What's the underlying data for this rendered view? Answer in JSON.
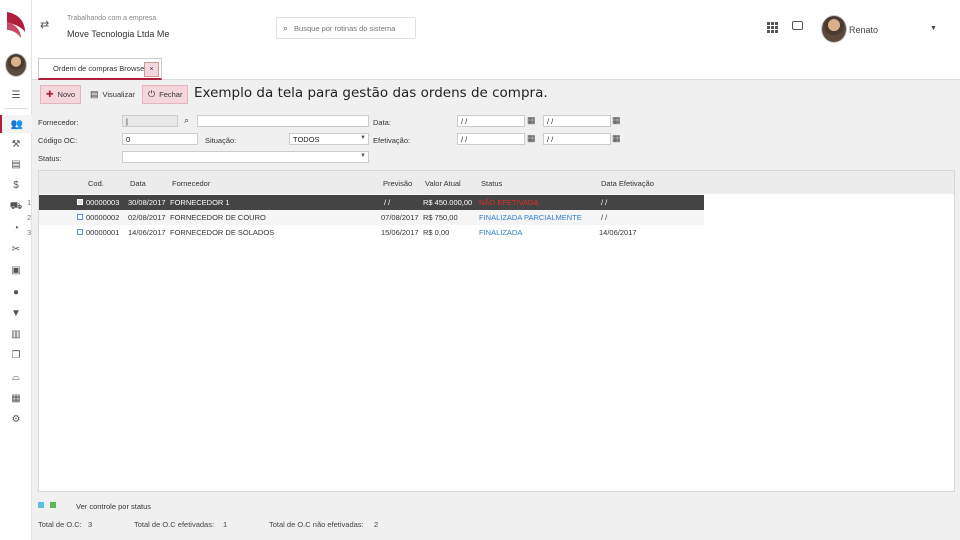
{
  "header": {
    "caption": "Trabalhando com a empresa",
    "company": "Move Tecnologia Ltda Me",
    "search_placeholder": "Busque por rotinas do sistema",
    "user_name": "Renato"
  },
  "tabs": [
    {
      "label": "Ordem de compras Browser",
      "close": "×"
    }
  ],
  "toolbar": {
    "new_label": "Novo",
    "view_label": "Visualizar",
    "close_label": "Fechar",
    "note": "Exemplo da tela para gestão das ordens de compra."
  },
  "filters": {
    "supplier_label": "Fornecedor:",
    "supplier_code": "|",
    "supplier_name": "",
    "oc_code_label": "Código OC:",
    "oc_code_value": "0",
    "situation_label": "Situação:",
    "situation_value": "TODOS",
    "status_label": "Status:",
    "status_value": "",
    "date_label": "Data:",
    "date_from": " / /",
    "date_to": " / /",
    "effective_label": "Efetivação:",
    "effective_from": " / /",
    "effective_to": " / /"
  },
  "grid": {
    "columns": [
      "Cod.",
      "Data",
      "Fornecedor",
      "Previsão",
      "Valor Atual",
      "Status",
      "Data Efetivação"
    ],
    "rows": [
      {
        "num": "1",
        "cod": "00000003",
        "data": "30/08/2017",
        "fornecedor": "FORNECEDOR 1",
        "previsao": " / /",
        "valor": "R$ 450.000,00",
        "status": "NÃO EFETIVADA",
        "status_color": "#d9302c",
        "efetivacao": " / /"
      },
      {
        "num": "2",
        "cod": "00000002",
        "data": "02/08/2017",
        "fornecedor": "FORNECEDOR DE COURO",
        "previsao": "07/08/2017",
        "valor": "R$ 750,00",
        "status": "FINALIZADA PARCIALMENTE",
        "status_color": "#2d7fd1",
        "efetivacao": " / /"
      },
      {
        "num": "3",
        "cod": "00000001",
        "data": "14/06/2017",
        "fornecedor": "FORNECEDOR DE SOLADOS",
        "previsao": "15/06/2017",
        "valor": "R$ 0,00",
        "status": "FINALIZADA",
        "status_color": "#2d7fd1",
        "efetivacao": "14/06/2017"
      }
    ]
  },
  "footer": {
    "legend_label": "Ver controle por status",
    "legend_colors": [
      "#5bc0de",
      "#5cb85c"
    ],
    "total_label": "Total de O.C:",
    "total_value": "3",
    "effective_label": "Total de O.C efetivadas:",
    "effective_value": "1",
    "not_effective_label": "Total de O.C não efetivadas:",
    "not_effective_value": "2"
  },
  "colors": {
    "brand": "#b01e3c",
    "toolbar_accent": "#f4d6dc",
    "selected_row": "#444444"
  },
  "icons": {
    "rail": [
      "menu-icon",
      "users-icon",
      "tools-icon",
      "calculator-icon",
      "dollar-icon",
      "truck-icon",
      "chart-pie-icon",
      "scissors-icon",
      "id-card-icon",
      "coins-icon",
      "filter-icon",
      "bar-chart-icon",
      "documents-icon",
      "shoe-icon",
      "apps-icon",
      "settings-icon"
    ]
  }
}
